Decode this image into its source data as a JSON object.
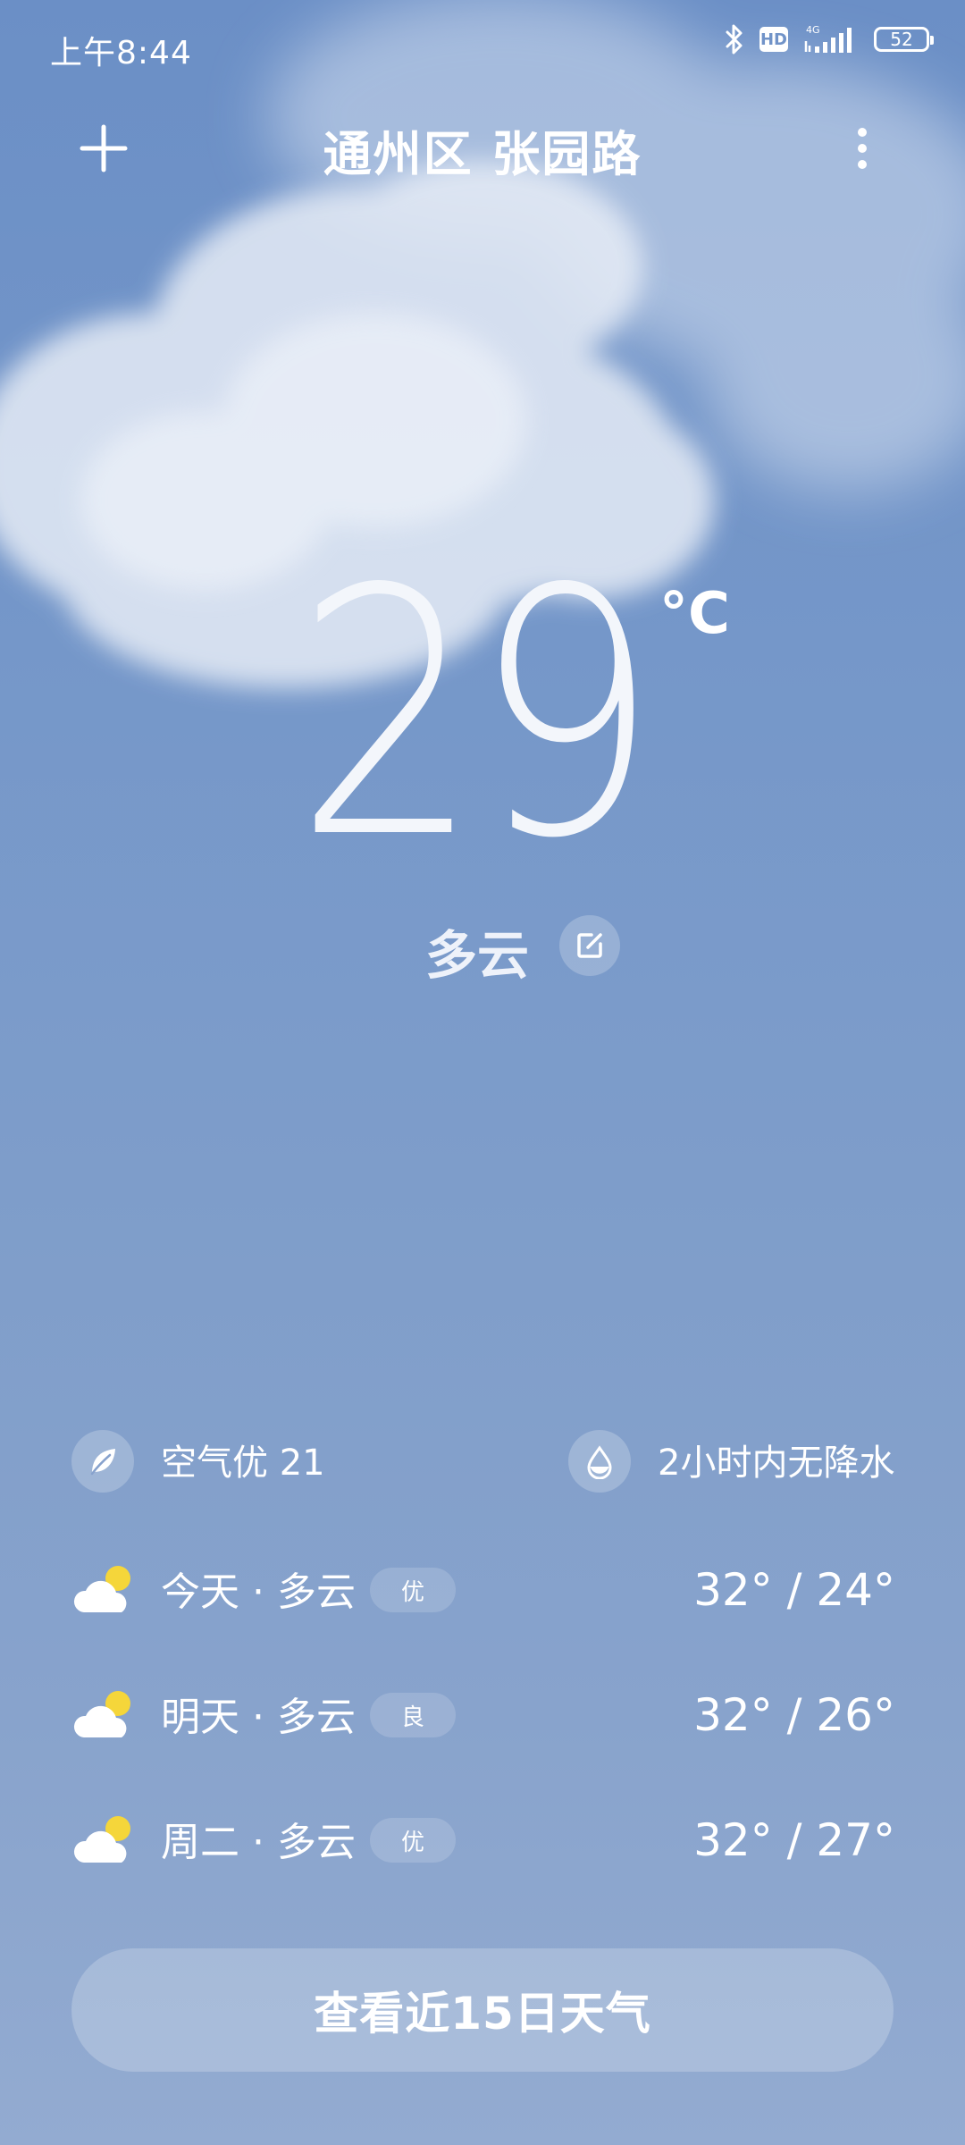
{
  "status_bar": {
    "time": "上午8:44",
    "network": "4G",
    "hd_label": "HD",
    "battery": "52"
  },
  "header": {
    "location": "通州区 张园路",
    "add_icon": "plus-icon",
    "more_icon": "more-vertical-icon"
  },
  "current": {
    "temperature": "29",
    "unit": "°C",
    "condition": "多云",
    "edit_icon": "edit-icon"
  },
  "info": {
    "air_quality": "空气优 21",
    "air_icon": "leaf-icon",
    "precipitation": "2小时内无降水",
    "precip_icon": "water-drop-icon"
  },
  "forecast": [
    {
      "label": "今天 · 多云",
      "aqi": "优",
      "temps": "32° / 24°",
      "icon": "partly-cloudy-icon"
    },
    {
      "label": "明天 · 多云",
      "aqi": "良",
      "temps": "32° / 26°",
      "icon": "partly-cloudy-icon"
    },
    {
      "label": "周二 · 多云",
      "aqi": "优",
      "temps": "32° / 27°",
      "icon": "partly-cloudy-icon"
    }
  ],
  "forecast_button": "查看近15日天气",
  "colors": {
    "sky_top": "#6b8fc6",
    "sky_bottom": "#93abd1",
    "sun": "#f5d63a"
  }
}
